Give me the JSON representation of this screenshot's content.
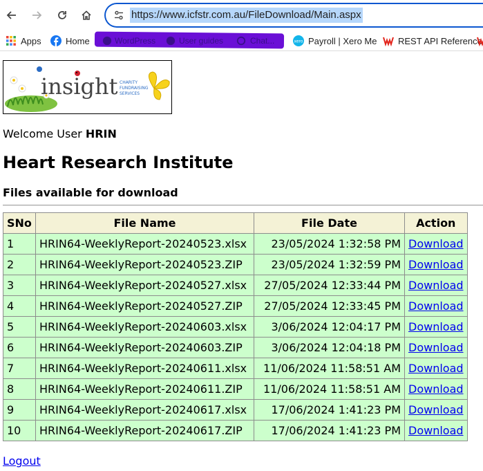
{
  "browser": {
    "url": "https://www.icfstr.com.au/FileDownload/Main.aspx",
    "bookmarks": [
      {
        "label": "Apps",
        "icon": "apps-grid-icon"
      },
      {
        "label": "Home",
        "icon": "facebook-icon"
      },
      {
        "label": "Payroll | Xero Me",
        "icon": "xero-icon"
      },
      {
        "label": "REST API Reference",
        "icon": "w-brand-icon"
      }
    ],
    "redacted_bookmarks": [
      "WordPress",
      "User guides",
      "Chat..."
    ]
  },
  "page": {
    "logo_alt": "insight charity fundraising services",
    "logo_word": "insight",
    "logo_tag_lines": [
      "CHARITY",
      "FUNDRAISING",
      "SERVICES"
    ],
    "welcome_prefix": "Welcome User",
    "user": "HRIN",
    "title": "Heart Research Institute",
    "subtitle": "Files available for download",
    "logout_label": "Logout"
  },
  "table": {
    "headers": [
      "SNo",
      "File Name",
      "File Date",
      "Action"
    ],
    "rows": [
      {
        "sno": "1",
        "name": "HRIN64-WeeklyReport-20240523.xlsx",
        "date": "23/05/2024 1:32:58 PM",
        "action": "Download"
      },
      {
        "sno": "2",
        "name": "HRIN64-WeeklyReport-20240523.ZIP",
        "date": "23/05/2024 1:32:59 PM",
        "action": "Download"
      },
      {
        "sno": "3",
        "name": "HRIN64-WeeklyReport-20240527.xlsx",
        "date": "27/05/2024 12:33:44 PM",
        "action": "Download"
      },
      {
        "sno": "4",
        "name": "HRIN64-WeeklyReport-20240527.ZIP",
        "date": "27/05/2024 12:33:45 PM",
        "action": "Download"
      },
      {
        "sno": "5",
        "name": "HRIN64-WeeklyReport-20240603.xlsx",
        "date": "3/06/2024 12:04:17 PM",
        "action": "Download"
      },
      {
        "sno": "6",
        "name": "HRIN64-WeeklyReport-20240603.ZIP",
        "date": "3/06/2024 12:04:18 PM",
        "action": "Download"
      },
      {
        "sno": "7",
        "name": "HRIN64-WeeklyReport-20240611.xlsx",
        "date": "11/06/2024 11:58:51 AM",
        "action": "Download"
      },
      {
        "sno": "8",
        "name": "HRIN64-WeeklyReport-20240611.ZIP",
        "date": "11/06/2024 11:58:51 AM",
        "action": "Download"
      },
      {
        "sno": "9",
        "name": "HRIN64-WeeklyReport-20240617.xlsx",
        "date": "17/06/2024 1:41:23 PM",
        "action": "Download"
      },
      {
        "sno": "10",
        "name": "HRIN64-WeeklyReport-20240617.ZIP",
        "date": "17/06/2024 1:41:23 PM",
        "action": "Download"
      }
    ]
  },
  "colors": {
    "header_bg": "#f4f2d6",
    "row_bg": "#ccffcc",
    "link": "#0000ee",
    "omnibox_focus": "#0b57d0",
    "redaction": "#6a0fd6"
  }
}
